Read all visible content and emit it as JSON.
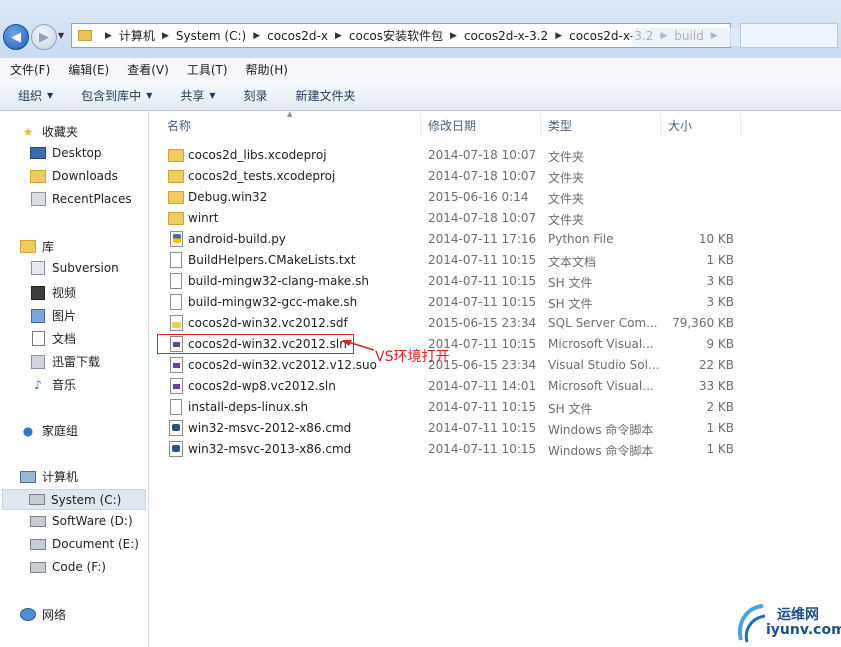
{
  "address": {
    "crumbs": [
      "计算机",
      "System (C:)",
      "cocos2d-x",
      "cocos安装软件包",
      "cocos2d-x-3.2",
      "cocos2d-x-3.2",
      "build"
    ]
  },
  "menu": [
    "文件(F)",
    "编辑(E)",
    "查看(V)",
    "工具(T)",
    "帮助(H)"
  ],
  "toolbar": {
    "organize": "组织",
    "include": "包含到库中",
    "share": "共享",
    "burn": "刻录",
    "new_folder": "新建文件夹"
  },
  "nav": {
    "favorites": "收藏夹",
    "desktop": "Desktop",
    "downloads": "Downloads",
    "recent": "RecentPlaces",
    "libraries": "库",
    "subversion": "Subversion",
    "video": "视频",
    "pictures": "图片",
    "documents": "文档",
    "thunder": "迅雷下载",
    "music": "音乐",
    "homegroup": "家庭组",
    "computer": "计算机",
    "drive_c": "System (C:)",
    "drive_d": "SoftWare (D:)",
    "drive_e": "Document (E:)",
    "drive_f": "Code (F:)",
    "network": "网络"
  },
  "columns": {
    "name": "名称",
    "date": "修改日期",
    "type": "类型",
    "size": "大小"
  },
  "files": [
    {
      "name": "cocos2d_libs.xcodeproj",
      "date": "2014-07-18 10:07",
      "type": "文件夹",
      "size": "",
      "icon": "folder"
    },
    {
      "name": "cocos2d_tests.xcodeproj",
      "date": "2014-07-18 10:07",
      "type": "文件夹",
      "size": "",
      "icon": "folder"
    },
    {
      "name": "Debug.win32",
      "date": "2015-06-16 0:14",
      "type": "文件夹",
      "size": "",
      "icon": "folder"
    },
    {
      "name": "winrt",
      "date": "2014-07-18 10:07",
      "type": "文件夹",
      "size": "",
      "icon": "folder"
    },
    {
      "name": "android-build.py",
      "date": "2014-07-11 17:16",
      "type": "Python File",
      "size": "10 KB",
      "icon": "python"
    },
    {
      "name": "BuildHelpers.CMakeLists.txt",
      "date": "2014-07-11 10:15",
      "type": "文本文档",
      "size": "1 KB",
      "icon": "text"
    },
    {
      "name": "build-mingw32-clang-make.sh",
      "date": "2014-07-11 10:15",
      "type": "SH 文件",
      "size": "3 KB",
      "icon": "blank"
    },
    {
      "name": "build-mingw32-gcc-make.sh",
      "date": "2014-07-11 10:15",
      "type": "SH 文件",
      "size": "3 KB",
      "icon": "blank"
    },
    {
      "name": "cocos2d-win32.vc2012.sdf",
      "date": "2015-06-15 23:34",
      "type": "SQL Server Com...",
      "size": "79,360 KB",
      "icon": "sdf"
    },
    {
      "name": "cocos2d-win32.vc2012.sln",
      "date": "2014-07-11 10:15",
      "type": "Microsoft Visual...",
      "size": "9 KB",
      "icon": "vs"
    },
    {
      "name": "cocos2d-win32.vc2012.v12.suo",
      "date": "2015-06-15 23:34",
      "type": "Visual Studio Sol...",
      "size": "22 KB",
      "icon": "vs"
    },
    {
      "name": "cocos2d-wp8.vc2012.sln",
      "date": "2014-07-11 14:01",
      "type": "Microsoft Visual...",
      "size": "33 KB",
      "icon": "vs"
    },
    {
      "name": "install-deps-linux.sh",
      "date": "2014-07-11 10:15",
      "type": "SH 文件",
      "size": "2 KB",
      "icon": "blank"
    },
    {
      "name": "win32-msvc-2012-x86.cmd",
      "date": "2014-07-11 10:15",
      "type": "Windows 命令脚本",
      "size": "1 KB",
      "icon": "cmd"
    },
    {
      "name": "win32-msvc-2013-x86.cmd",
      "date": "2014-07-11 10:15",
      "type": "Windows 命令脚本",
      "size": "1 KB",
      "icon": "cmd"
    }
  ],
  "annotation": "VS环境打开",
  "watermark": {
    "top": "运维网",
    "bottom": "iyunv.com"
  },
  "colors": {
    "annotation": "#e02020",
    "accent": "#1e395b"
  }
}
